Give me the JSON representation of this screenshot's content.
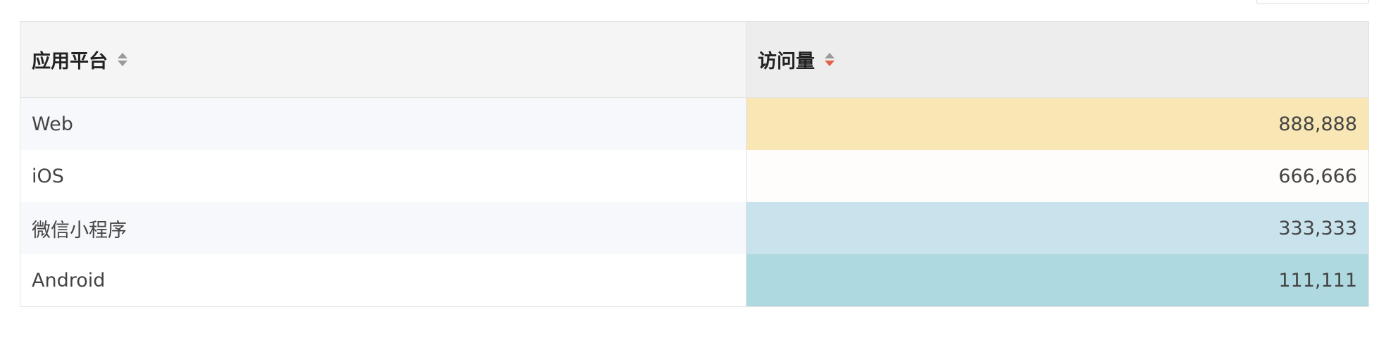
{
  "table": {
    "headers": {
      "platform": "应用平台",
      "visits": "访问量"
    },
    "sort": {
      "platform": "none",
      "visits": "descending"
    },
    "rows": [
      {
        "platform": "Web",
        "visits": "888,888",
        "heat_color": "#f9e6b5"
      },
      {
        "platform": "iOS",
        "visits": "666,666",
        "heat_color": "#fefdfb"
      },
      {
        "platform": "微信小程序",
        "visits": "333,333",
        "heat_color": "#c9e3ec"
      },
      {
        "platform": "Android",
        "visits": "111,111",
        "heat_color": "#afd9e0"
      }
    ]
  },
  "colors": {
    "sort_active": "#e0624a",
    "header_bg": "#f5f5f5",
    "header_active_bg": "#ededed",
    "stripe_bg": "#f7f8fc"
  }
}
